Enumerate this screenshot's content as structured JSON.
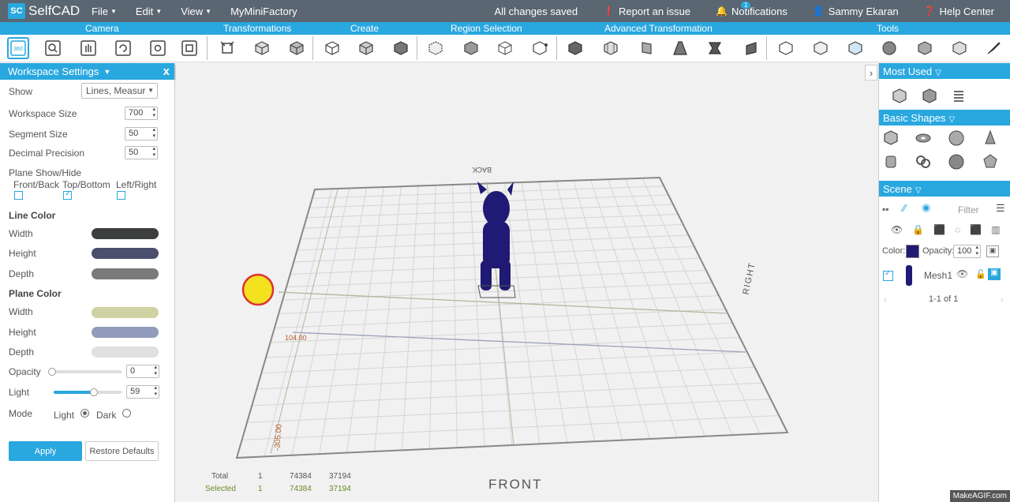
{
  "app": {
    "name": "SelfCAD",
    "logo_mark": "SC"
  },
  "menu": [
    {
      "label": "File"
    },
    {
      "label": "Edit"
    },
    {
      "label": "View"
    },
    {
      "label": "MyMiniFactory"
    }
  ],
  "topright": {
    "saved": "All changes saved",
    "report": "Report an issue",
    "notifications": "Notifications",
    "notif_count": "1",
    "user": "Sammy Ekaran",
    "help": "Help Center"
  },
  "categories": [
    "Camera",
    "Transformations",
    "Create",
    "Region Selection",
    "Advanced Transformation",
    "Tools"
  ],
  "workspace": {
    "title": "Workspace Settings",
    "close": "x",
    "show_label": "Show",
    "show_value": "Lines, Measur",
    "workspace_size_label": "Workspace Size",
    "workspace_size": "700",
    "segment_size_label": "Segment Size",
    "segment_size": "50",
    "decimal_label": "Decimal Precision",
    "decimal": "50",
    "plane_label": "Plane Show/Hide",
    "front_back": "Front/Back",
    "top_bottom": "Top/Bottom",
    "left_right": "Left/Right",
    "line_color_label": "Line Color",
    "plane_color_label": "Plane Color",
    "width_label": "Width",
    "height_label": "Height",
    "depth_label": "Depth",
    "opacity_label": "Opacity",
    "opacity": "0",
    "light_label": "Light",
    "light": "59",
    "light_level": 0.59,
    "mode_label": "Mode",
    "mode_light": "Light",
    "mode_dark": "Dark",
    "apply": "Apply",
    "restore": "Restore Defaults"
  },
  "colors": {
    "accent": "#29a7df",
    "line_width": "#3d3f3f",
    "line_height": "#4a4f6e",
    "line_depth": "#7a7a7a",
    "plane_width": "#cfd3a3",
    "plane_height": "#929cba",
    "plane_depth": "#e0e0e0",
    "mesh": "#1f1a73"
  },
  "viewport": {
    "back": "BACK",
    "front": "FRONT",
    "right": "RIGHT",
    "measure1": "104.00",
    "measure2": "-305.00"
  },
  "stats": {
    "total_label": "Total",
    "total_count": "1",
    "total_a": "74384",
    "total_b": "37194",
    "selected_label": "Selected",
    "selected_count": "1",
    "selected_a": "74384",
    "selected_b": "37194"
  },
  "right": {
    "most_used": "Most Used",
    "basic_shapes": "Basic Shapes",
    "scene": "Scene",
    "filter_placeholder": "Filter",
    "color_label": "Color:",
    "opacity_label": "Opacity:",
    "opacity": "100",
    "mesh_name": "Mesh1",
    "pagination": "1-1 of 1"
  },
  "watermark": "MakeAGIF.com"
}
